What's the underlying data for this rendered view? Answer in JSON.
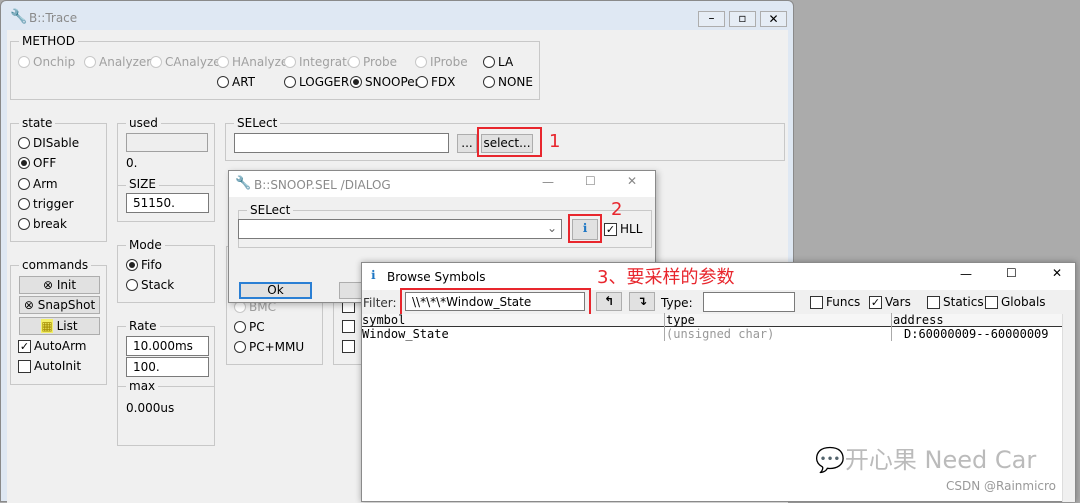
{
  "trace_window": {
    "title": "B::Trace",
    "method": {
      "label": "METHOD",
      "row1": [
        "Onchip",
        "Analyzer",
        "CAnalyzer",
        "HAnalyzer",
        "Integrator",
        "Probe",
        "IProbe",
        "LA"
      ],
      "row2": [
        "ART",
        "LOGGER",
        "SNOOPer",
        "FDX",
        "NONE"
      ],
      "selected": "SNOOPer"
    },
    "state": {
      "label": "state",
      "options": [
        "DISable",
        "OFF",
        "Arm",
        "trigger",
        "break"
      ],
      "selected": "OFF"
    },
    "commands": {
      "label": "commands",
      "buttons": [
        "Init",
        "SnapShot",
        "List"
      ],
      "autoarm": "AutoArm",
      "autoinit": "AutoInit",
      "autoarm_checked": true,
      "autoinit_checked": false
    },
    "used": {
      "label": "used",
      "value": "0."
    },
    "size": {
      "label": "SIZE",
      "value": "51150."
    },
    "mode": {
      "label": "Mode",
      "options": [
        "Fifo",
        "Stack"
      ],
      "selected": "Fifo"
    },
    "rate": {
      "label": "Rate",
      "value1": "10.000ms",
      "value2": "100."
    },
    "max": {
      "label": "max",
      "value": "0.000us"
    },
    "select": {
      "label": "SELect",
      "value": "",
      "dots": "...",
      "button": "select..."
    },
    "partial_group": {
      "options": [
        "BMC",
        "PC",
        "PC+MMU"
      ]
    }
  },
  "snoop_dialog": {
    "title": "B::SNOOP.SEL /DIALOG",
    "select_label": "SELect",
    "combo_value": "",
    "hll": "HLL",
    "hll_checked": true,
    "ok": "Ok"
  },
  "browse": {
    "title": "Browse Symbols",
    "filter_label": "Filter:",
    "filter_value": "\\\\*\\*\\*Window_State",
    "type_label": "Type:",
    "type_value": "",
    "checks": [
      {
        "label": "Funcs",
        "checked": false
      },
      {
        "label": "Vars",
        "checked": true
      },
      {
        "label": "Statics",
        "checked": false
      },
      {
        "label": "Globals",
        "checked": false
      }
    ],
    "columns": [
      "symbol",
      "type",
      "address"
    ],
    "rows": [
      {
        "symbol": "Window_State",
        "type": "(unsigned char)",
        "address": "D:60000009--60000009"
      }
    ]
  },
  "annotations": {
    "a1": "1",
    "a2": "2",
    "a3": "3、要采样的参数"
  },
  "watermark": {
    "brand": "开心果 Need Car",
    "credit": "CSDN @Rainmicro"
  },
  "colors": {
    "annotation": "#e8262d",
    "desktop": "#ababab",
    "window": "#f0f0f0"
  }
}
